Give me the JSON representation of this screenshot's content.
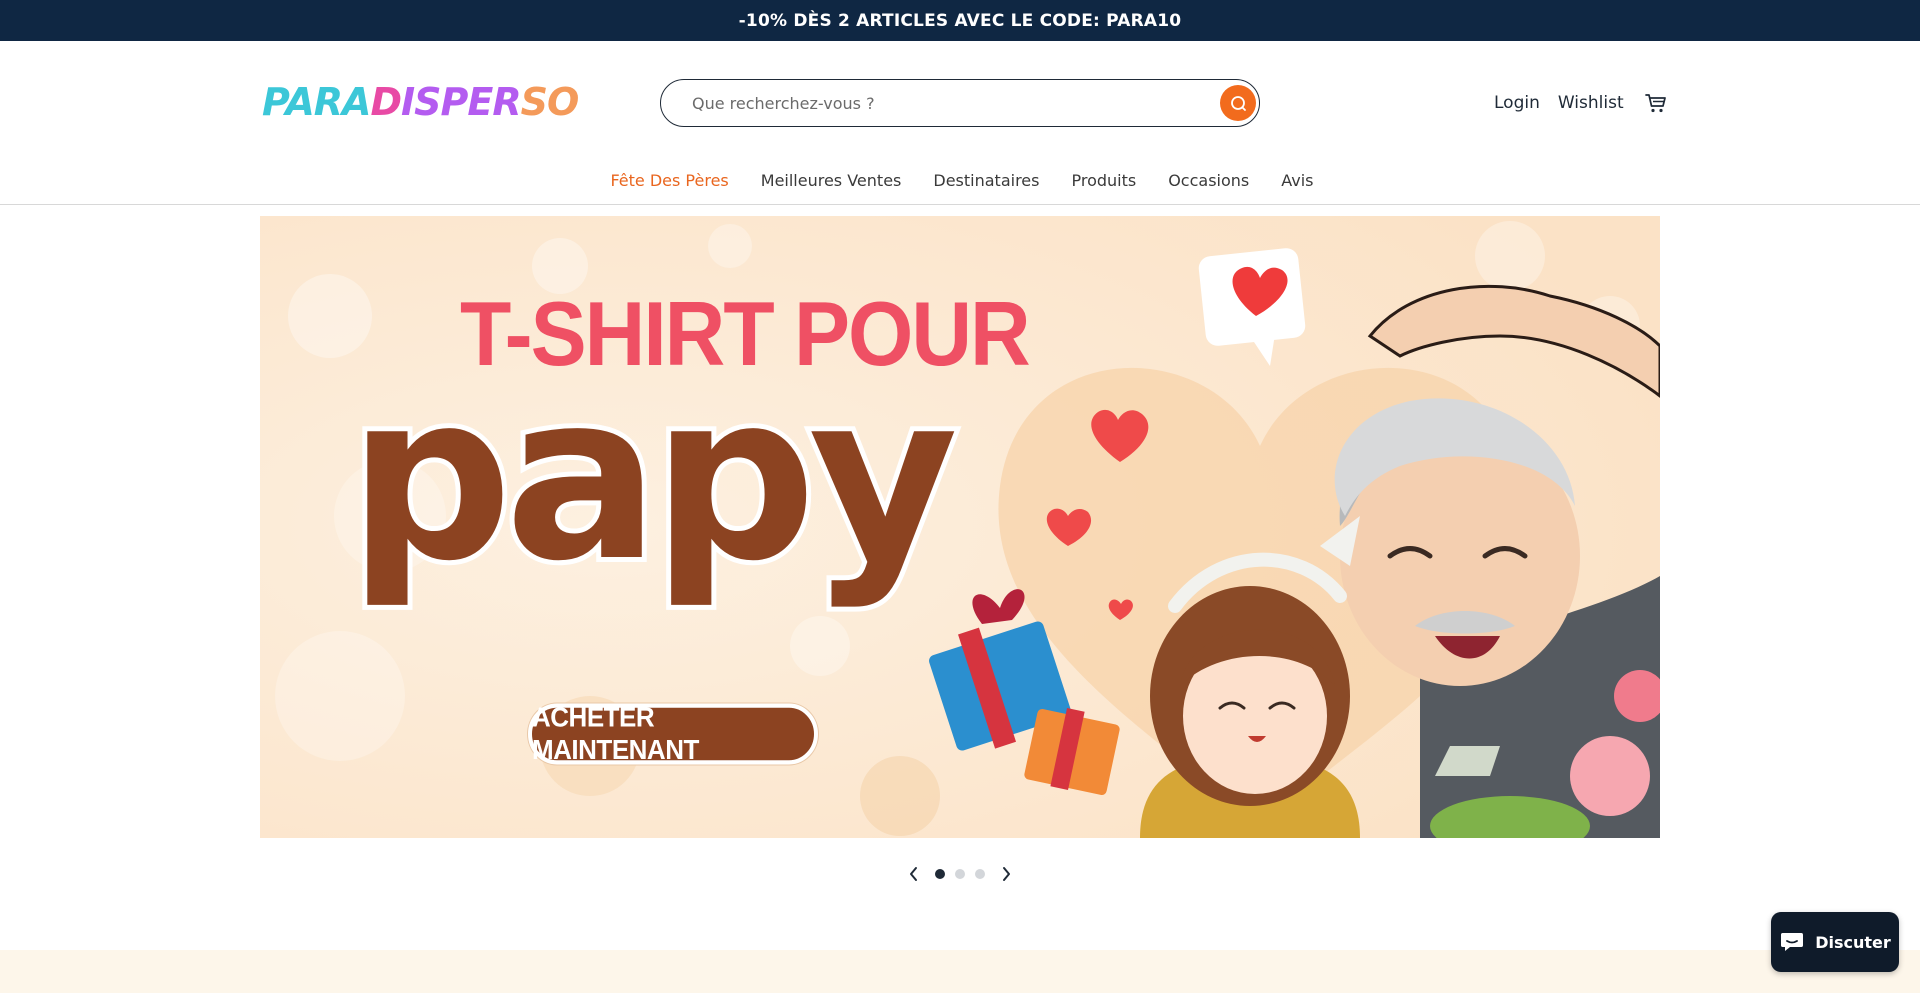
{
  "promo": {
    "text": "-10% DÈS 2 ARTICLES AVEC LE CODE: PARA10"
  },
  "header": {
    "logo_parts": [
      "PARA",
      "D",
      "ISPER",
      "SO"
    ],
    "search": {
      "placeholder": "Que recherchez-vous ?",
      "value": ""
    },
    "login_label": "Login",
    "wishlist_label": "Wishlist",
    "icons": {
      "search": "search-icon",
      "cart": "cart-icon"
    }
  },
  "nav": {
    "items": [
      {
        "label": "Fête Des Pères",
        "active": true
      },
      {
        "label": "Meilleures Ventes",
        "active": false
      },
      {
        "label": "Destinataires",
        "active": false
      },
      {
        "label": "Produits",
        "active": false
      },
      {
        "label": "Occasions",
        "active": false
      },
      {
        "label": "Avis",
        "active": false
      }
    ]
  },
  "hero": {
    "title": "T-SHIRT POUR",
    "headline": "papy",
    "cta_label": "ACHETER MAINTENANT",
    "slide_count": 3,
    "active_slide": 1
  },
  "chat": {
    "label": "Discuter"
  },
  "colors": {
    "promo_bg": "#0f2743",
    "accent": "#f26b1d",
    "nav_active": "#e9661f",
    "hero_bg": "#fce9d3",
    "headline": "#8c4321",
    "hero_title": "#ef5064",
    "chat_bg": "#0f1b2a"
  }
}
